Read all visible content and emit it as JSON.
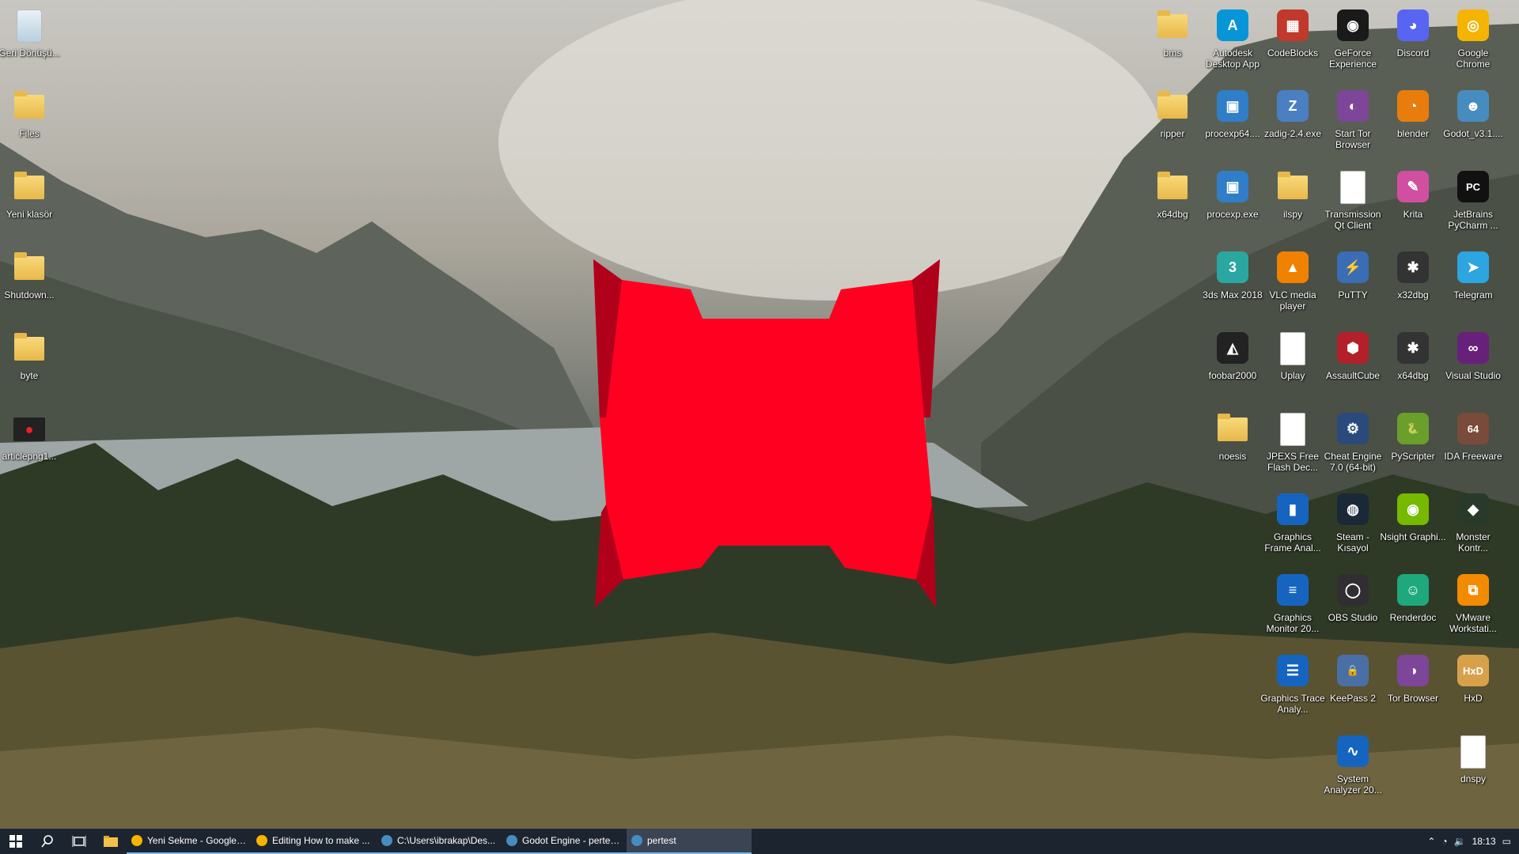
{
  "desktop": {
    "left_icons": [
      {
        "label": "Geri Dönüşü...",
        "icon": "recycle-bin-icon",
        "kind": "recycle"
      },
      {
        "label": "Files",
        "icon": "folder-icon",
        "kind": "folder"
      },
      {
        "label": "Yeni klasör",
        "icon": "folder-icon",
        "kind": "folder"
      },
      {
        "label": "Shutdown...",
        "icon": "folder-icon",
        "kind": "folder"
      },
      {
        "label": "byte",
        "icon": "folder-icon",
        "kind": "folder"
      },
      {
        "label": "articlepng1...",
        "icon": "image-file-icon",
        "kind": "image"
      }
    ],
    "right_icons": [
      {
        "label": "bms",
        "icon": "folder-icon",
        "kind": "folder"
      },
      {
        "label": "Autodesk Desktop App",
        "icon": "autodesk-icon",
        "kind": "app",
        "color": "#0696d7",
        "text": "A"
      },
      {
        "label": "CodeBlocks",
        "icon": "codeblocks-icon",
        "kind": "app",
        "color": "#c0392b",
        "text": "▦"
      },
      {
        "label": "GeForce Experience",
        "icon": "geforce-icon",
        "kind": "app",
        "color": "#1a1a1a",
        "text": "◉"
      },
      {
        "label": "Discord",
        "icon": "discord-icon",
        "kind": "app",
        "color": "#5865f2",
        "text": "◕"
      },
      {
        "label": "Google Chrome",
        "icon": "chrome-icon",
        "kind": "app",
        "color": "#f4b400",
        "text": "◎"
      },
      {
        "label": "ripper",
        "icon": "folder-icon",
        "kind": "folder"
      },
      {
        "label": "procexp64....",
        "icon": "procexp-icon",
        "kind": "app",
        "color": "#2f7ec7",
        "text": "▣"
      },
      {
        "label": "zadig-2.4.exe",
        "icon": "zadig-icon",
        "kind": "app",
        "color": "#4a7fc1",
        "text": "Z"
      },
      {
        "label": "Start Tor Browser",
        "icon": "tor-icon",
        "kind": "app",
        "color": "#7d4698",
        "text": "◐"
      },
      {
        "label": "blender",
        "icon": "blender-icon",
        "kind": "app",
        "color": "#e87d0d",
        "text": "◔"
      },
      {
        "label": "Godot_v3.1....",
        "icon": "godot-icon",
        "kind": "app",
        "color": "#478cbf",
        "text": "☻"
      },
      {
        "label": "x64dbg",
        "icon": "folder-icon",
        "kind": "folder"
      },
      {
        "label": "procexp.exe",
        "icon": "procexp-icon",
        "kind": "app",
        "color": "#2f7ec7",
        "text": "▣"
      },
      {
        "label": "ilspy",
        "icon": "folder-icon",
        "kind": "folder"
      },
      {
        "label": "Transmission Qt Client",
        "icon": "file-icon",
        "kind": "doc"
      },
      {
        "label": "Krita",
        "icon": "krita-icon",
        "kind": "app",
        "color": "#d04fa0",
        "text": "✎"
      },
      {
        "label": "JetBrains PyCharm ...",
        "icon": "pycharm-icon",
        "kind": "app",
        "color": "#111",
        "text": "PC"
      },
      {
        "label": "3ds Max 2018",
        "icon": "3dsmax-icon",
        "kind": "app",
        "color": "#2aa7a0",
        "text": "3"
      },
      {
        "label": "VLC media player",
        "icon": "vlc-icon",
        "kind": "app",
        "color": "#f08200",
        "text": "▲"
      },
      {
        "label": "PuTTY",
        "icon": "putty-icon",
        "kind": "app",
        "color": "#3a6db5",
        "text": "⚡"
      },
      {
        "label": "x32dbg",
        "icon": "bug-icon",
        "kind": "app",
        "color": "#333",
        "text": "✱"
      },
      {
        "label": "Telegram",
        "icon": "telegram-icon",
        "kind": "app",
        "color": "#2ca5e0",
        "text": "➤"
      },
      {
        "label": "foobar2000",
        "icon": "foobar-icon",
        "kind": "app",
        "color": "#222",
        "text": "◭"
      },
      {
        "label": "Uplay",
        "icon": "file-icon",
        "kind": "doc"
      },
      {
        "label": "AssaultCube",
        "icon": "assaultcube-icon",
        "kind": "app",
        "color": "#b3202a",
        "text": "⬢"
      },
      {
        "label": "x64dbg",
        "icon": "bug-icon",
        "kind": "app",
        "color": "#333",
        "text": "✱"
      },
      {
        "label": "Visual Studio",
        "icon": "visual-studio-icon",
        "kind": "app",
        "color": "#68217a",
        "text": "∞"
      },
      {
        "label": "noesis",
        "icon": "folder-icon",
        "kind": "folder"
      },
      {
        "label": "JPEXS Free Flash Dec...",
        "icon": "file-icon",
        "kind": "doc"
      },
      {
        "label": "Cheat Engine 7.0 (64-bit)",
        "icon": "cheat-engine-icon",
        "kind": "app",
        "color": "#2b4a7c",
        "text": "⚙"
      },
      {
        "label": "PyScripter",
        "icon": "pyscripter-icon",
        "kind": "app",
        "color": "#6a9f2b",
        "text": "🐍"
      },
      {
        "label": "IDA Freeware",
        "icon": "ida-icon",
        "kind": "app",
        "color": "#7a4a3a",
        "text": "64"
      },
      {
        "label": "Graphics Frame Anal...",
        "icon": "graphics-frame-icon",
        "kind": "app",
        "color": "#1565c0",
        "text": "▮"
      },
      {
        "label": "Steam - Kısayol",
        "icon": "steam-icon",
        "kind": "app",
        "color": "#1b2838",
        "text": "◍"
      },
      {
        "label": "Nsight Graphi...",
        "icon": "nsight-icon",
        "kind": "app",
        "color": "#76b900",
        "text": "◉"
      },
      {
        "label": "Monster Kontr...",
        "icon": "monster-icon",
        "kind": "app",
        "color": "#2a3a2a",
        "text": "◆"
      },
      {
        "label": "Graphics Monitor 20...",
        "icon": "graphics-monitor-icon",
        "kind": "app",
        "color": "#1565c0",
        "text": "≡"
      },
      {
        "label": "OBS Studio",
        "icon": "obs-icon",
        "kind": "app",
        "color": "#302e31",
        "text": "◯"
      },
      {
        "label": "Renderdoc",
        "icon": "renderdoc-icon",
        "kind": "app",
        "color": "#1fa87b",
        "text": "☺"
      },
      {
        "label": "VMware Workstati...",
        "icon": "vmware-icon",
        "kind": "app",
        "color": "#f38b00",
        "text": "⧉"
      },
      {
        "label": "Graphics Trace Analy...",
        "icon": "graphics-trace-icon",
        "kind": "app",
        "color": "#1565c0",
        "text": "☰"
      },
      {
        "label": "KeePass 2",
        "icon": "keepass-icon",
        "kind": "app",
        "color": "#4a6fa5",
        "text": "🔒"
      },
      {
        "label": "Tor Browser",
        "icon": "tor-browser-icon",
        "kind": "app",
        "color": "#7d4698",
        "text": "◑"
      },
      {
        "label": "HxD",
        "icon": "hxd-icon",
        "kind": "app",
        "color": "#d7a14b",
        "text": "HxD"
      },
      {
        "label": "System Analyzer 20...",
        "icon": "system-analyzer-icon",
        "kind": "app",
        "color": "#1565c0",
        "text": "∿"
      },
      {
        "label": "dnspy",
        "icon": "dnspy-icon",
        "kind": "doc"
      }
    ]
  },
  "overlay": {
    "color": "#ff0020",
    "shade": "#b0001a"
  },
  "taskbar": {
    "tasks": [
      {
        "label": "Yeni Sekme - Google ...",
        "icon": "chrome-icon",
        "color": "#f4b400"
      },
      {
        "label": "Editing How to make ...",
        "icon": "chrome-icon",
        "color": "#f4b400"
      },
      {
        "label": "C:\\Users\\ibrakap\\Des...",
        "icon": "console-icon",
        "color": "#478cbf"
      },
      {
        "label": "Godot Engine - pertes...",
        "icon": "godot-icon",
        "color": "#478cbf"
      },
      {
        "label": "pertest",
        "icon": "godot-icon",
        "color": "#478cbf"
      }
    ],
    "clock": "18:13"
  }
}
